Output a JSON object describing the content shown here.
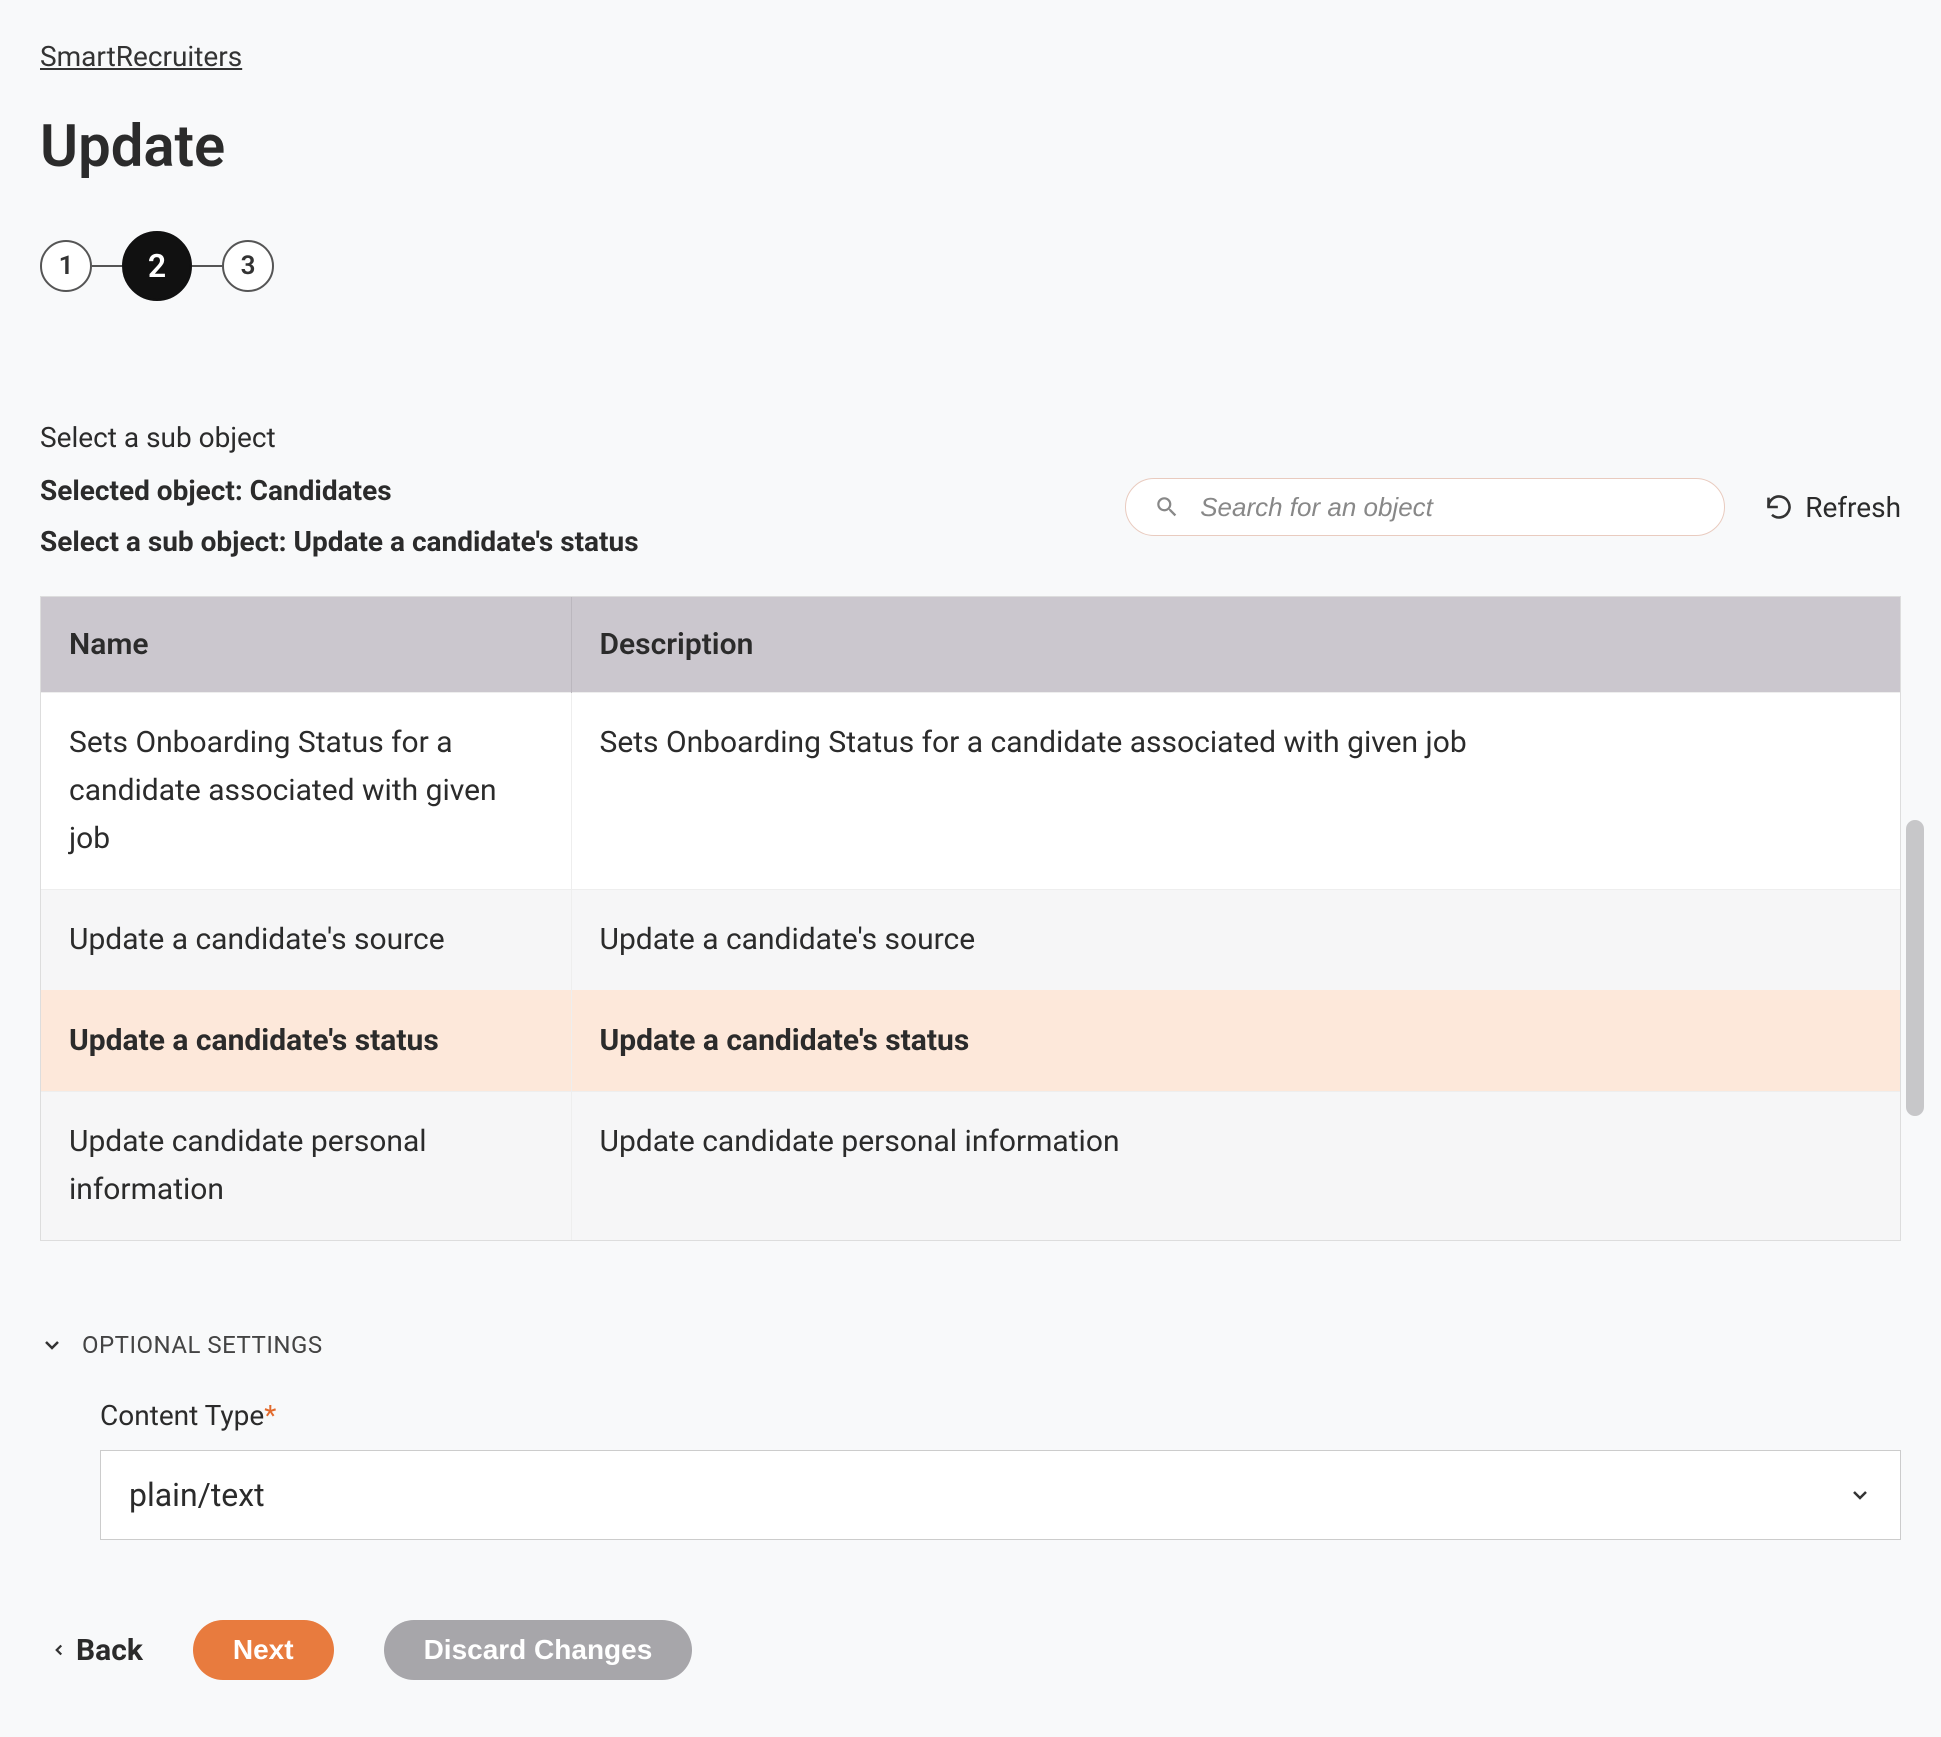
{
  "breadcrumb": "SmartRecruiters",
  "page_title": "Update",
  "stepper": {
    "steps": [
      "1",
      "2",
      "3"
    ],
    "active_index": 1
  },
  "subheader": {
    "select_line": "Select a sub object",
    "selected_object_label": "Selected object: Candidates",
    "select_sub_object_label": "Select a sub object: Update a candidate's status"
  },
  "search": {
    "placeholder": "Search for an object"
  },
  "refresh_label": "Refresh",
  "table": {
    "columns": [
      "Name",
      "Description"
    ],
    "rows": [
      {
        "name": "Sets Onboarding Status for a candidate associated with given job",
        "description": "Sets Onboarding Status for a candidate associated with given job",
        "selected": false
      },
      {
        "name": "Update a candidate's source",
        "description": "Update a candidate's source",
        "selected": false
      },
      {
        "name": "Update a candidate's status",
        "description": "Update a candidate's status",
        "selected": true
      },
      {
        "name": "Update candidate personal information",
        "description": "Update candidate personal information",
        "selected": false
      }
    ]
  },
  "optional_settings": {
    "header": "OPTIONAL SETTINGS",
    "content_type_label": "Content Type",
    "content_type_value": "plain/text"
  },
  "buttons": {
    "back": "Back",
    "next": "Next",
    "discard": "Discard Changes"
  }
}
